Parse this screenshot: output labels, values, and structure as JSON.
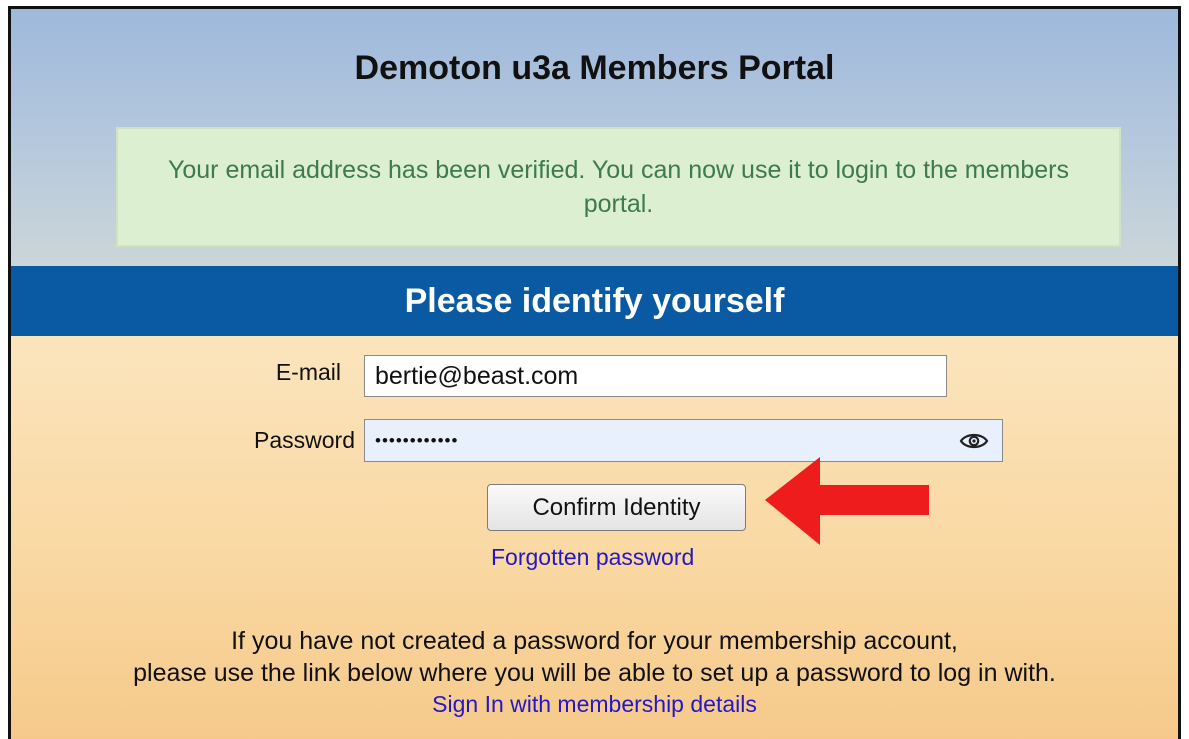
{
  "portal": {
    "title": "Demoton u3a Members Portal",
    "notice": "Your email address has been verified. You can now use it to login to the members portal."
  },
  "identify": {
    "heading": "Please identify yourself",
    "email_label": "E-mail",
    "email_value": "bertie@beast.com",
    "password_label": "Password",
    "password_mask": "••••••••••••",
    "confirm_button": "Confirm Identity",
    "forgotten_link": "Forgotten password"
  },
  "footer": {
    "line1": "If you have not created a password for your membership account,",
    "line2": "please use the link below where you will be able to set up a password to log in with.",
    "signin_link": "Sign In with membership details"
  },
  "colors": {
    "band": "#0a5aa3",
    "notice_bg": "#dcefd0",
    "notice_text": "#3d7a4e",
    "link": "#2418c6",
    "annotation_arrow": "#ee1c1c"
  },
  "icons": {
    "password_toggle": "eye-icon",
    "annotation": "arrow-left-icon"
  }
}
